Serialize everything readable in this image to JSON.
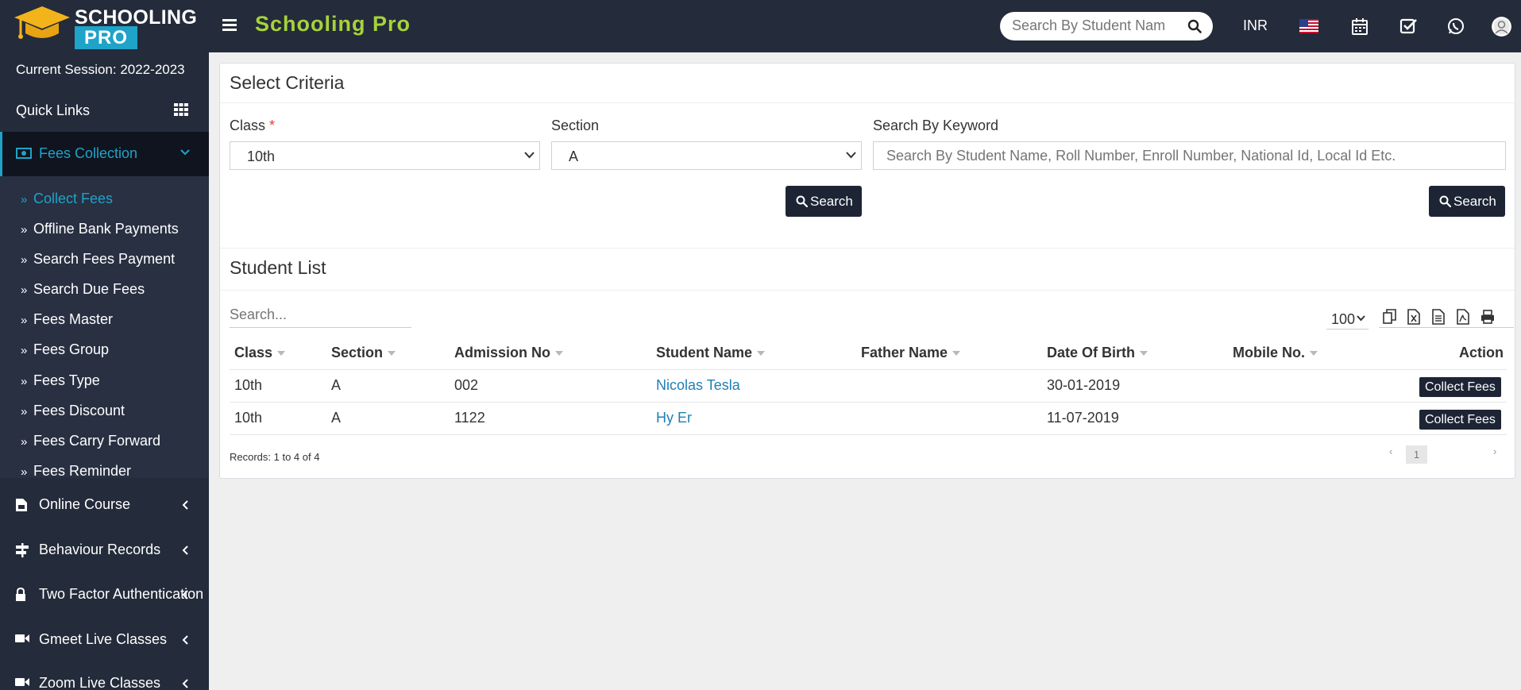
{
  "header": {
    "logo_line1": "SCHOOLING",
    "logo_line2": "PRO",
    "app_title": "Schooling Pro",
    "search_placeholder": "Search By Student Nam",
    "currency": "INR",
    "accent_color": "#1fa3c9",
    "title_color": "#a6d33a",
    "icons": [
      "menu-icon",
      "search-icon",
      "us-flag-icon",
      "calendar-icon",
      "check-square-icon",
      "whatsapp-icon",
      "user-avatar-icon"
    ]
  },
  "sidebar": {
    "session": "Current Session: 2022-2023",
    "quick_links": "Quick Links",
    "active_menu": "Fees Collection",
    "submenu": [
      {
        "label": "Collect Fees"
      },
      {
        "label": "Offline Bank Payments"
      },
      {
        "label": "Search Fees Payment"
      },
      {
        "label": "Search Due Fees"
      },
      {
        "label": "Fees Master"
      },
      {
        "label": "Fees Group"
      },
      {
        "label": "Fees Type"
      },
      {
        "label": "Fees Discount"
      },
      {
        "label": "Fees Carry Forward"
      },
      {
        "label": "Fees Reminder"
      }
    ],
    "menus": [
      {
        "label": "Online Course",
        "icon": "online-course-icon"
      },
      {
        "label": "Behaviour Records",
        "icon": "signpost-icon"
      },
      {
        "label": "Two Factor Authentication",
        "icon": "lock-icon"
      },
      {
        "label": "Gmeet Live Classes",
        "icon": "video-icon"
      },
      {
        "label": "Zoom Live Classes",
        "icon": "video-icon"
      }
    ]
  },
  "criteria": {
    "title": "Select Criteria",
    "class_label": "Class",
    "required_mark": "*",
    "class_value": "10th",
    "section_label": "Section",
    "section_value": "A",
    "keyword_label": "Search By Keyword",
    "keyword_placeholder": "Search By Student Name, Roll Number, Enroll Number, National Id, Local Id Etc.",
    "search_button": "Search",
    "keyword_search_button": "Search"
  },
  "student_list": {
    "title": "Student List",
    "search_placeholder": "Search...",
    "page_size": "100",
    "tools": [
      "copy-icon",
      "excel-icon",
      "csv-icon",
      "pdf-icon",
      "print-icon"
    ],
    "columns": [
      "Class",
      "Section",
      "Admission No",
      "Student Name",
      "Father Name",
      "Date Of Birth",
      "Mobile No.",
      "Action"
    ],
    "rows": [
      {
        "class": "10th",
        "section": "A",
        "admission_no": "002",
        "student_name": "Nicolas Tesla",
        "father_name": "",
        "dob": "30-01-2019",
        "mobile": "",
        "action": "Collect Fees"
      },
      {
        "class": "10th",
        "section": "A",
        "admission_no": "1122",
        "student_name": "Hy Er",
        "father_name": "",
        "dob": "11-07-2019",
        "mobile": "",
        "action": "Collect Fees"
      }
    ],
    "records_text": "Records: 1 to 4 of 4",
    "current_page": "1",
    "prev": "‹",
    "next": "›"
  }
}
